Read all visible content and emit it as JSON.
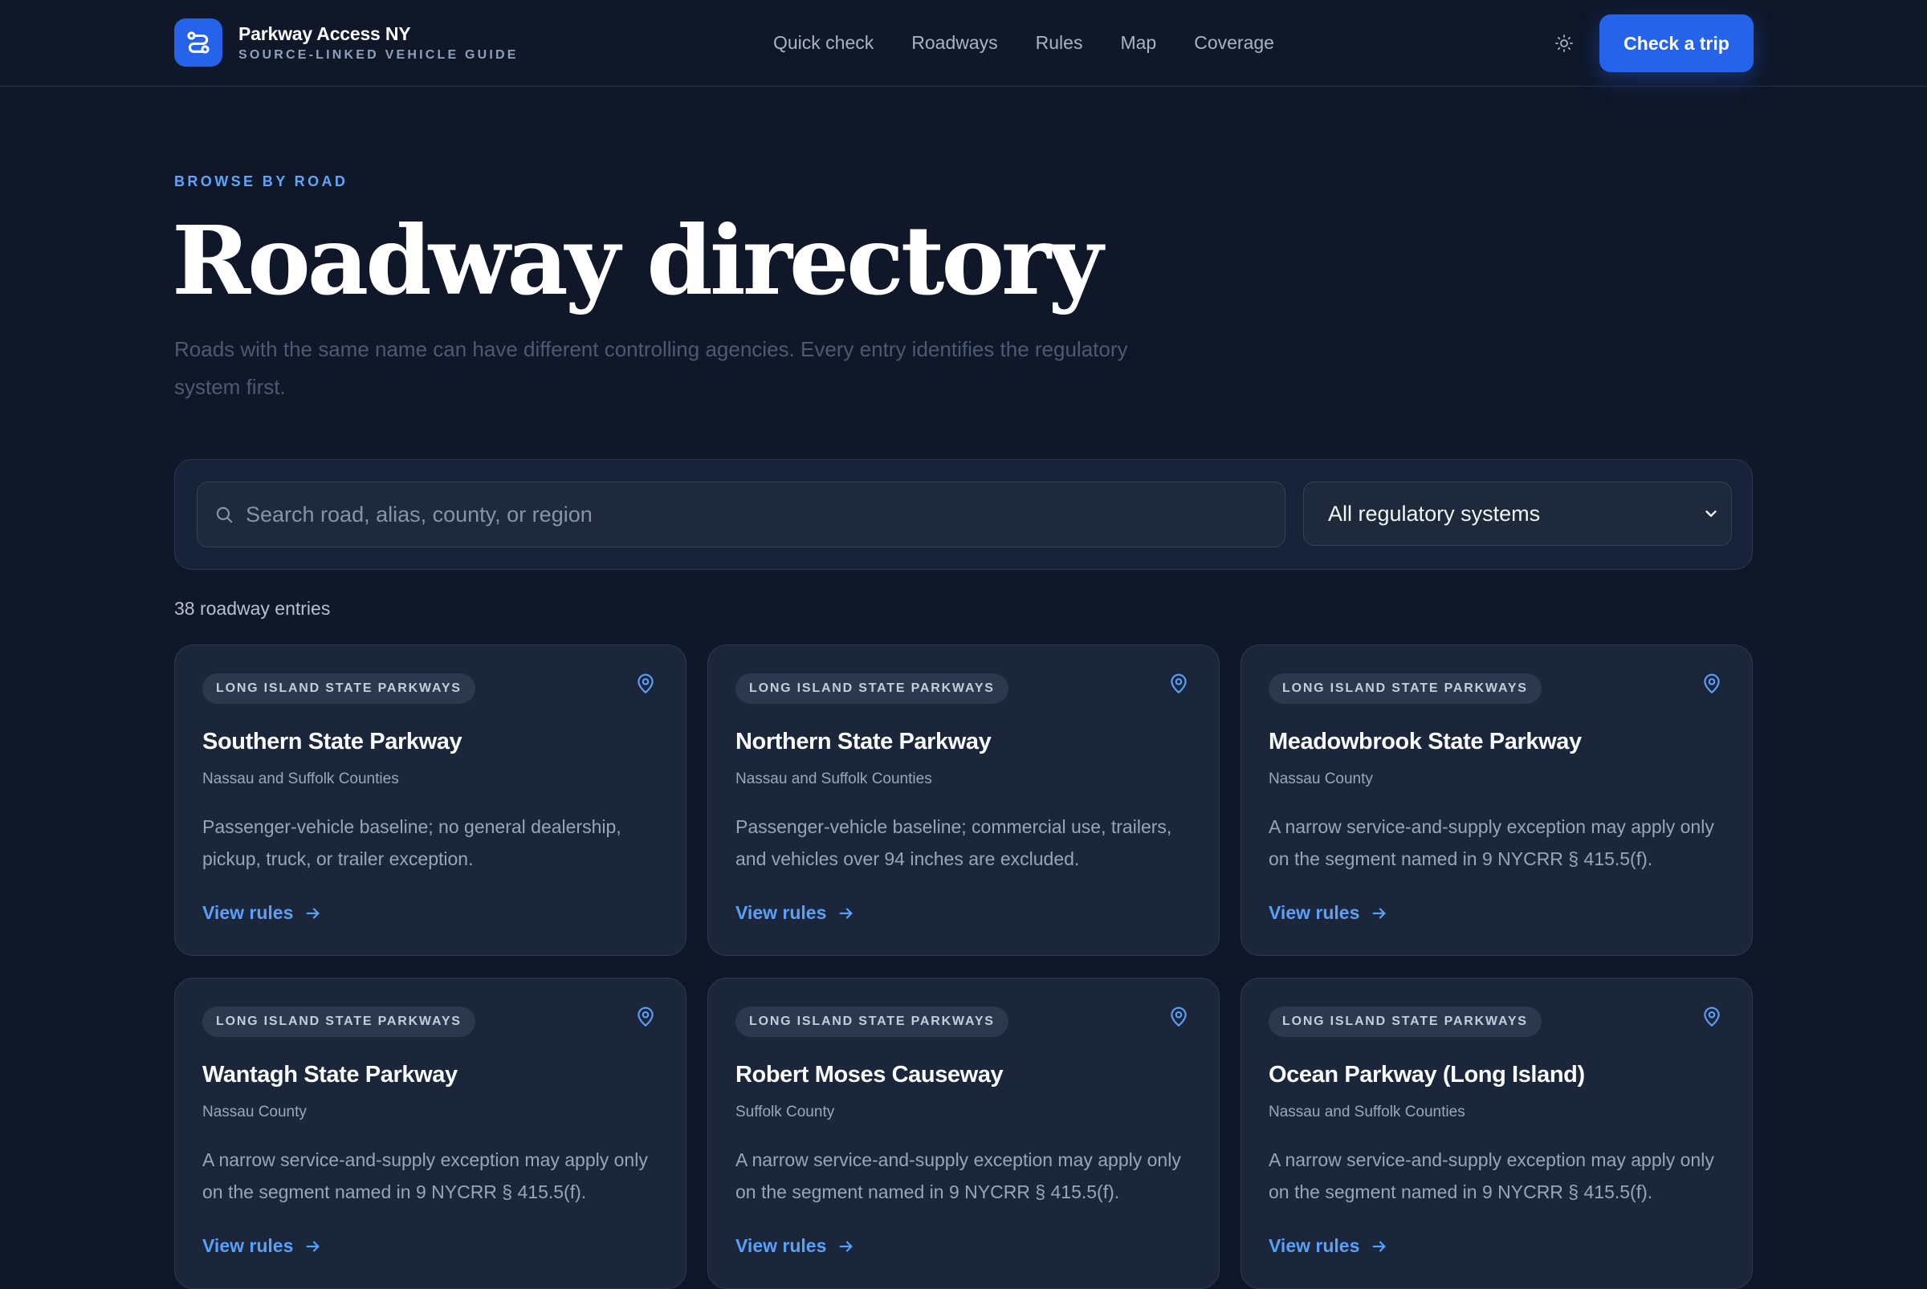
{
  "brand": {
    "title": "Parkway Access NY",
    "subtitle": "SOURCE-LINKED VEHICLE GUIDE",
    "icon": "route-icon",
    "accent": "#2563eb"
  },
  "nav": {
    "items": [
      "Quick check",
      "Roadways",
      "Rules",
      "Map",
      "Coverage"
    ],
    "theme_icon": "sun-icon",
    "cta_label": "Check a trip"
  },
  "hero": {
    "eyebrow": "BROWSE BY ROAD",
    "title": "Roadway directory",
    "description": "Roads with the same name can have different controlling agencies. Every entry identifies the regulatory system first."
  },
  "filters": {
    "search_placeholder": "Search road, alias, county, or region",
    "search_value": "",
    "system_selected": "All regulatory systems"
  },
  "results": {
    "count_label": "38 roadway entries"
  },
  "cards": [
    {
      "system": "LONG ISLAND STATE PARKWAYS",
      "name": "Southern State Parkway",
      "region": "Nassau and Suffolk Counties",
      "description": "Passenger-vehicle baseline; no general dealership, pickup, truck, or trailer exception.",
      "link": "View rules"
    },
    {
      "system": "LONG ISLAND STATE PARKWAYS",
      "name": "Northern State Parkway",
      "region": "Nassau and Suffolk Counties",
      "description": "Passenger-vehicle baseline; commercial use, trailers, and vehicles over 94 inches are excluded.",
      "link": "View rules"
    },
    {
      "system": "LONG ISLAND STATE PARKWAYS",
      "name": "Meadowbrook State Parkway",
      "region": "Nassau County",
      "description": "A narrow service-and-supply exception may apply only on the segment named in 9 NYCRR § 415.5(f).",
      "link": "View rules"
    },
    {
      "system": "LONG ISLAND STATE PARKWAYS",
      "name": "Wantagh State Parkway",
      "region": "Nassau County",
      "description": "A narrow service-and-supply exception may apply only on the segment named in 9 NYCRR § 415.5(f).",
      "link": "View rules"
    },
    {
      "system": "LONG ISLAND STATE PARKWAYS",
      "name": "Robert Moses Causeway",
      "region": "Suffolk County",
      "description": "A narrow service-and-supply exception may apply only on the segment named in 9 NYCRR § 415.5(f).",
      "link": "View rules"
    },
    {
      "system": "LONG ISLAND STATE PARKWAYS",
      "name": "Ocean Parkway (Long Island)",
      "region": "Nassau and Suffolk Counties",
      "description": "A narrow service-and-supply exception may apply only on the segment named in 9 NYCRR § 415.5(f).",
      "link": "View rules"
    }
  ]
}
